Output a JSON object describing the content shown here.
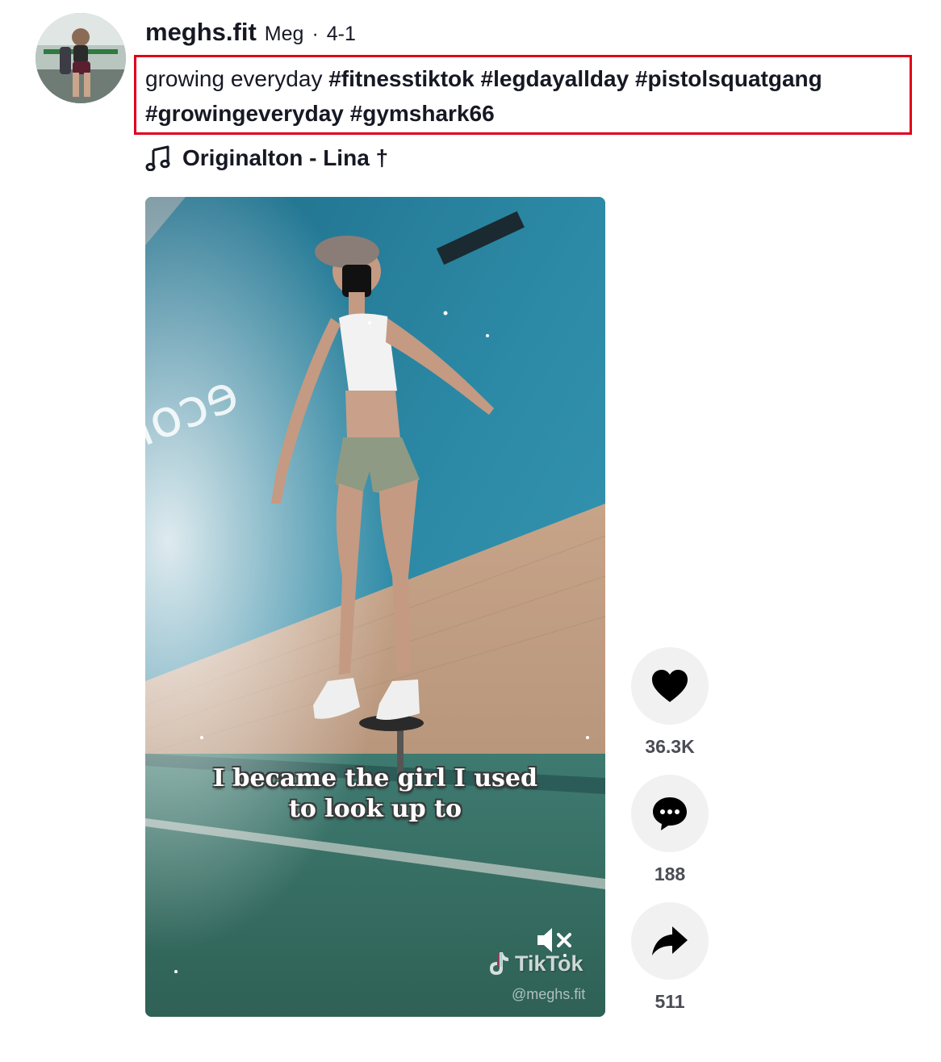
{
  "post": {
    "username": "meghs.fit",
    "nickname": "Meg",
    "separator": "·",
    "date": "4-1",
    "caption_text": "growing everyday",
    "hashtags": [
      "#fitnesstiktok",
      "#legdayallday",
      "#pistolsquatgang",
      "#growingeveryday",
      "#gymshark66"
    ],
    "music": {
      "icon": "music-note-icon",
      "title": "Originalton - Lina †"
    }
  },
  "video": {
    "subtitle_line1": "I became the girl I used",
    "subtitle_line2": "to look up to",
    "watermark_brand": "TikTok",
    "watermark_handle": "@meghs.fit",
    "muted": true
  },
  "actions": {
    "likes": "36.3K",
    "comments": "188",
    "shares": "511"
  },
  "colors": {
    "highlight_border": "#e1001a",
    "text_primary": "#161823",
    "count_text": "#4b4c55",
    "action_bg": "#f1f1f2"
  }
}
